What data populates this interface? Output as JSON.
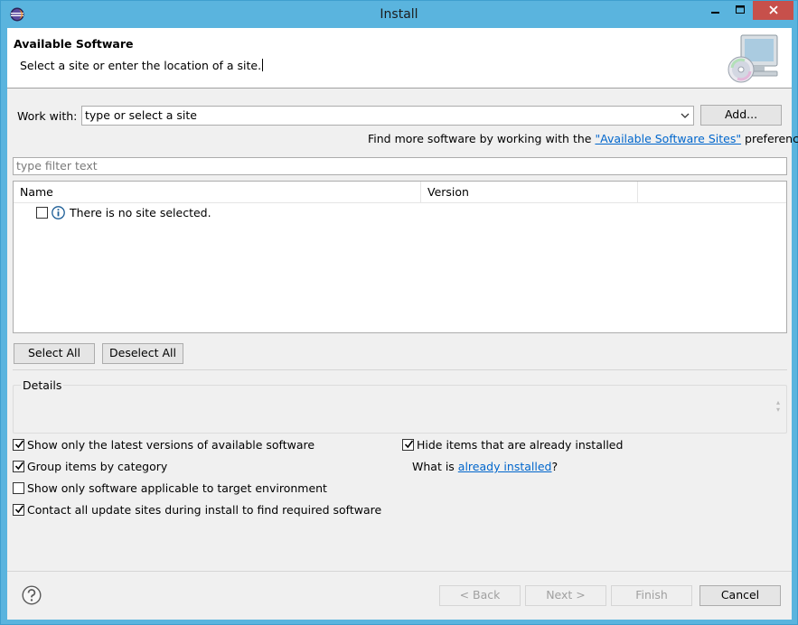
{
  "window": {
    "title": "Install"
  },
  "header": {
    "title": "Available Software",
    "description": "Select a site or enter the location of a site."
  },
  "work_with": {
    "label": "Work with:",
    "value": "type or select a site",
    "add_button": "Add..."
  },
  "find_more": {
    "prefix": "Find more software by working with the ",
    "link": "\"Available Software Sites\"",
    "suffix": " preferences."
  },
  "filter": {
    "placeholder": "type filter text"
  },
  "table": {
    "columns": [
      "Name",
      "Version"
    ],
    "rows": [
      {
        "checked": false,
        "icon": "info-icon",
        "text": "There is no site selected."
      }
    ]
  },
  "selection_buttons": {
    "select_all": "Select All",
    "deselect_all": "Deselect All"
  },
  "details": {
    "label": "Details"
  },
  "options": {
    "latest_versions": {
      "label": "Show only the latest versions of available software",
      "checked": true
    },
    "group_by_category": {
      "label": "Group items by category",
      "checked": true
    },
    "applicable_only": {
      "label": "Show only software applicable to target environment",
      "checked": false
    },
    "contact_sites": {
      "label": "Contact all update sites during install to find required software",
      "checked": true
    },
    "hide_installed": {
      "label": "Hide items that are already installed",
      "checked": true
    },
    "what_is": {
      "prefix": "What is ",
      "link": "already installed",
      "suffix": "?"
    }
  },
  "footer": {
    "back": "< Back",
    "next": "Next >",
    "finish": "Finish",
    "cancel": "Cancel"
  },
  "colors": {
    "window_frame": "#5ab4de",
    "close_button": "#c7504b",
    "link": "#0066cc",
    "dialog_bg": "#f0f0f0"
  }
}
